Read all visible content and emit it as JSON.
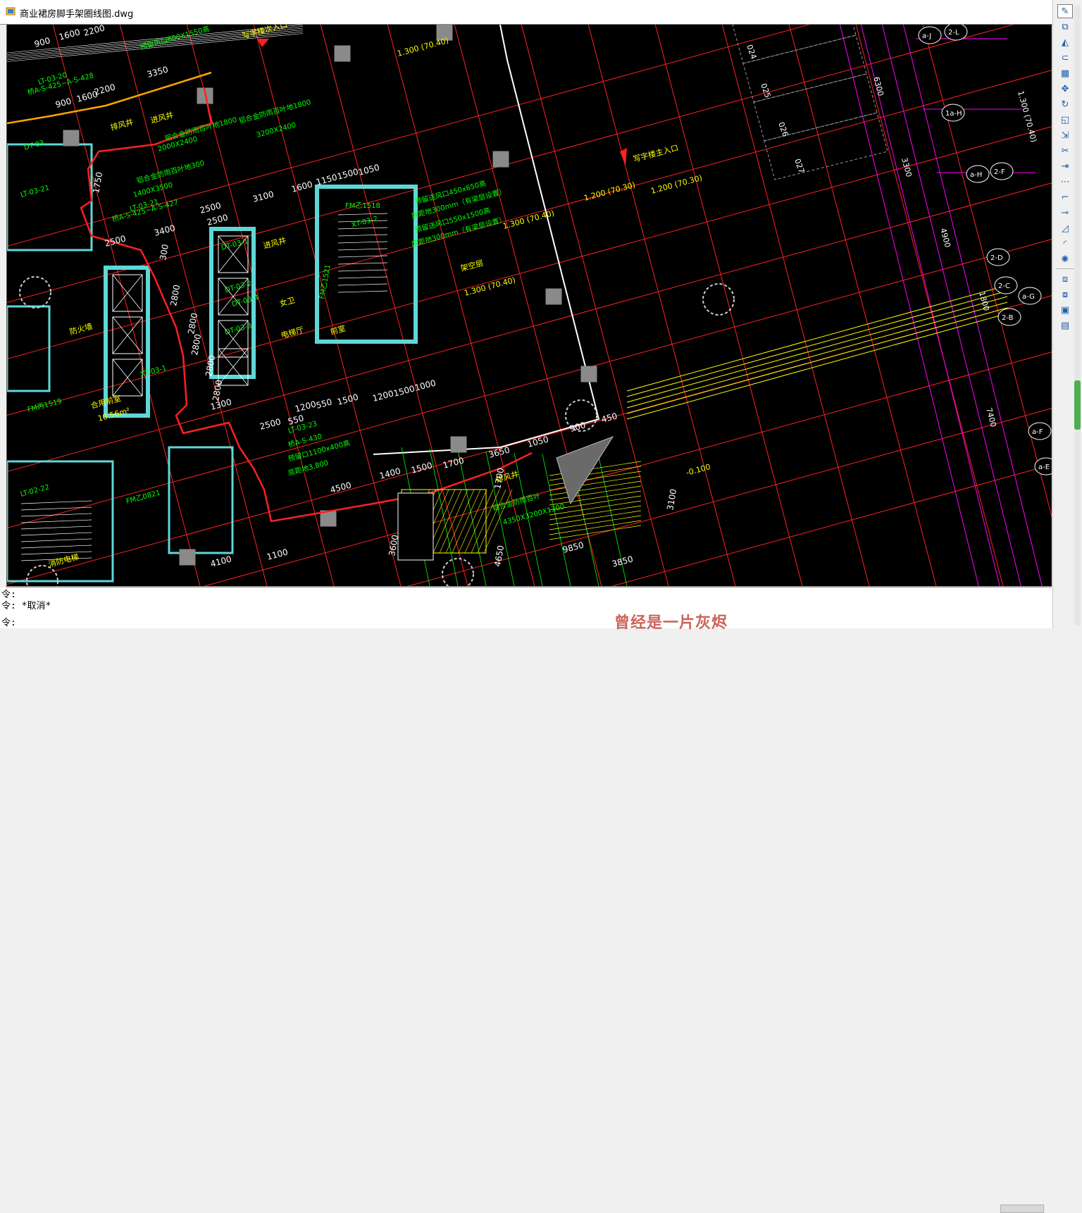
{
  "window": {
    "title": "商业裙房脚手架圈线图.dwg"
  },
  "drawing": {
    "labels_yellow": [
      "写字楼次入口",
      "写字楼主入口",
      "架空层",
      "1.300 (70.40)",
      "1.200 (70.30)",
      "1.200 (70.30)",
      "1.300 (70.40)",
      "1.300 (70.40)",
      "-0.100",
      "进风井",
      "女卫",
      "电梯厅",
      "前室",
      "排风井",
      "合用前室",
      "10.56m²",
      "防火墙",
      "消防电梯",
      "排风井",
      "进风井"
    ],
    "labels_white": [
      "900",
      "1600",
      "2200",
      "900",
      "1600",
      "2200",
      "3350",
      "2500",
      "3100",
      "1600",
      "1150",
      "1500",
      "1050",
      "2500",
      "3400",
      "2500",
      "300",
      "2800",
      "2800",
      "2800",
      "2800",
      "2800",
      "1200",
      "550",
      "1500",
      "1200",
      "1500",
      "1000",
      "2500",
      "550",
      "1400",
      "1500",
      "1700",
      "3650",
      "1050",
      "4500",
      "3600",
      "4100",
      "1100",
      "900",
      "450",
      "3100",
      "3850",
      "1300",
      "1700",
      "1750",
      "4650",
      "9850"
    ],
    "labels_green": [
      "LT-03-20",
      "LT-03-21",
      "LT-03-23",
      "LT-02-22",
      "LT-03-21",
      "桥A-S-425~A-S-428",
      "桥A-S-425~A-S-427",
      "桥A-S-430",
      "预留风口600X1550高",
      "预留送风口450x650高",
      "底距地300mm（有梁层设置）",
      "预留送风口550x1500高",
      "底距地300mm（有梁层设置）",
      "预留口1100x400高",
      "底距地3.800",
      "铝合金防雨百叶地1800",
      "3200X2400",
      "2000X2400",
      "1400X3500",
      "铝合金防雨百叶地1800",
      "铝合金防雨百叶地300",
      "铝合金防雨百叶",
      "4350X3200X1300",
      "FM乙1518",
      "FM乙1521",
      "FM乙0821",
      "FM丙1519",
      "DT-03-1",
      "DT-03-2",
      "DT-03-3",
      "DT-03-4",
      "XT-03-2",
      "XT-03-1",
      "DT-03"
    ],
    "labels_axis": [
      "a-J",
      "2-L",
      "1a-H",
      "a-H",
      "2-F",
      "2-D",
      "2-C",
      "a-G",
      "2-B",
      "a-F",
      "a-E",
      "1.300 (70.40)",
      "024",
      "025",
      "026",
      "027",
      "6300",
      "1800",
      "7400",
      "4900",
      "3300"
    ]
  },
  "toolbar": {
    "tools": [
      "line-tool-icon",
      "copy-icon",
      "mirror-icon",
      "offset-icon",
      "array-icon",
      "move-icon",
      "rotate-icon",
      "scale-icon",
      "stretch-icon",
      "trim-icon",
      "extend-icon",
      "break-point-icon",
      "break-icon",
      "join-icon",
      "chamfer-icon",
      "fillet-icon",
      "explode-icon",
      "draworder-front-icon",
      "draworder-back-icon",
      "draworder-above-icon",
      "draworder-under-icon"
    ]
  },
  "command": {
    "line1": "令:",
    "line2": "令: *取消*",
    "line3": "令:"
  },
  "watermark": {
    "text": "曾经是一片灰烬"
  },
  "colors": {
    "canvas": "#000000",
    "red": "#ff2020",
    "yellow": "#ffff00",
    "green": "#00ff00",
    "cyan": "#5fd7d7",
    "magenta": "#ff00ff",
    "orange": "#ffa500",
    "white": "#ffffff"
  }
}
